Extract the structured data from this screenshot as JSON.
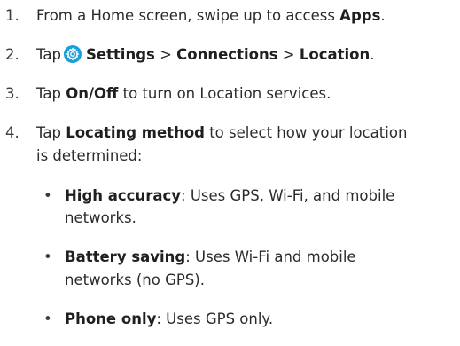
{
  "steps": [
    {
      "number": "1.",
      "prefix": "From a Home screen, swipe up to access ",
      "bold": "Apps",
      "suffix": "."
    },
    {
      "number": "2.",
      "prefix": "Tap",
      "icon": "settings-gear-icon",
      "bold_1": "Settings",
      "sep_1": " > ",
      "bold_2": "Connections",
      "sep_2": " > ",
      "bold_3": "Location",
      "suffix": "."
    },
    {
      "number": "3.",
      "prefix": "Tap ",
      "bold": "On/Off",
      "suffix": " to turn on Location services."
    },
    {
      "number": "4.",
      "prefix": "Tap ",
      "bold": "Locating method",
      "suffix_line1": " to select how your location",
      "line2": "is determined:"
    }
  ],
  "bullets": [
    {
      "marker": "•",
      "bold": "High accuracy",
      "line1": ": Uses GPS, Wi-Fi, and mobile",
      "line2": "networks."
    },
    {
      "marker": "•",
      "bold": "Battery saving",
      "line1": ": Uses Wi-Fi and mobile",
      "line2": "networks (no GPS)."
    },
    {
      "marker": "•",
      "bold": "Phone only",
      "line1": ": Uses GPS only."
    }
  ],
  "colors": {
    "text": "#2b2b2b",
    "settings_icon_bg": "#1b9fd8"
  }
}
